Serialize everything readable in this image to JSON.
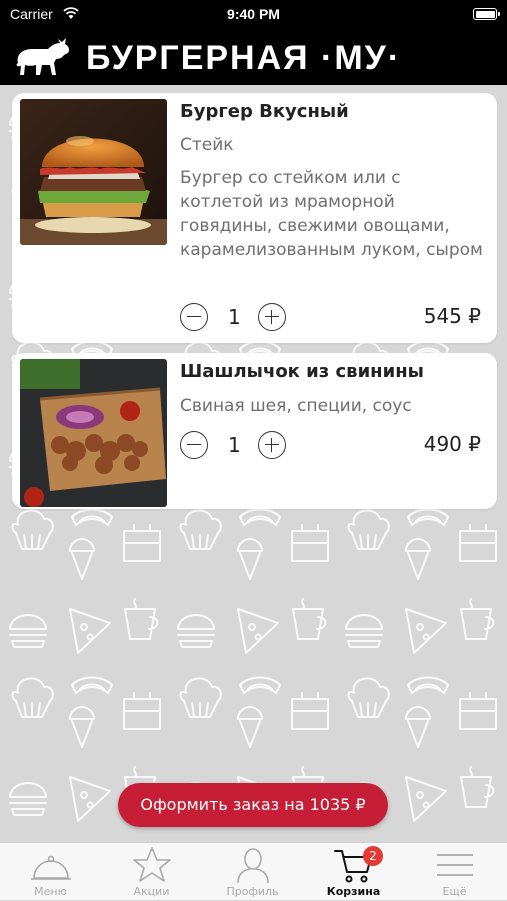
{
  "status_bar": {
    "carrier": "Carrier",
    "time": "9:40 PM"
  },
  "header": {
    "brand": "БУРГЕРНАЯ ·МУ·"
  },
  "cart_items": [
    {
      "name": "Бургер Вкусный",
      "subtitle": "Стейк",
      "description": "Бургер со стейком или с котлетой из мраморной говядины, свежими овощами, карамелизованным луком, сыром сулугуни и соусом на ос...",
      "quantity": "1",
      "price": "545 ₽"
    },
    {
      "name": "Шашлычок из свинины",
      "description": "Свиная шея, специи, соус",
      "quantity": "1",
      "price": "490 ₽"
    }
  ],
  "order_button": {
    "label": "Оформить заказ на 1035 ₽"
  },
  "tabs": [
    {
      "label": "Меню",
      "icon": "cloche-icon",
      "active": false
    },
    {
      "label": "Акции",
      "icon": "star-icon",
      "active": false
    },
    {
      "label": "Профиль",
      "icon": "user-icon",
      "active": false
    },
    {
      "label": "Корзина",
      "icon": "cart-icon",
      "active": true,
      "badge": "2"
    },
    {
      "label": "Ещё",
      "icon": "menu-icon",
      "active": false
    }
  ],
  "colors": {
    "accent": "#c61e36",
    "badge": "#e53935",
    "header_bg": "#000000"
  }
}
